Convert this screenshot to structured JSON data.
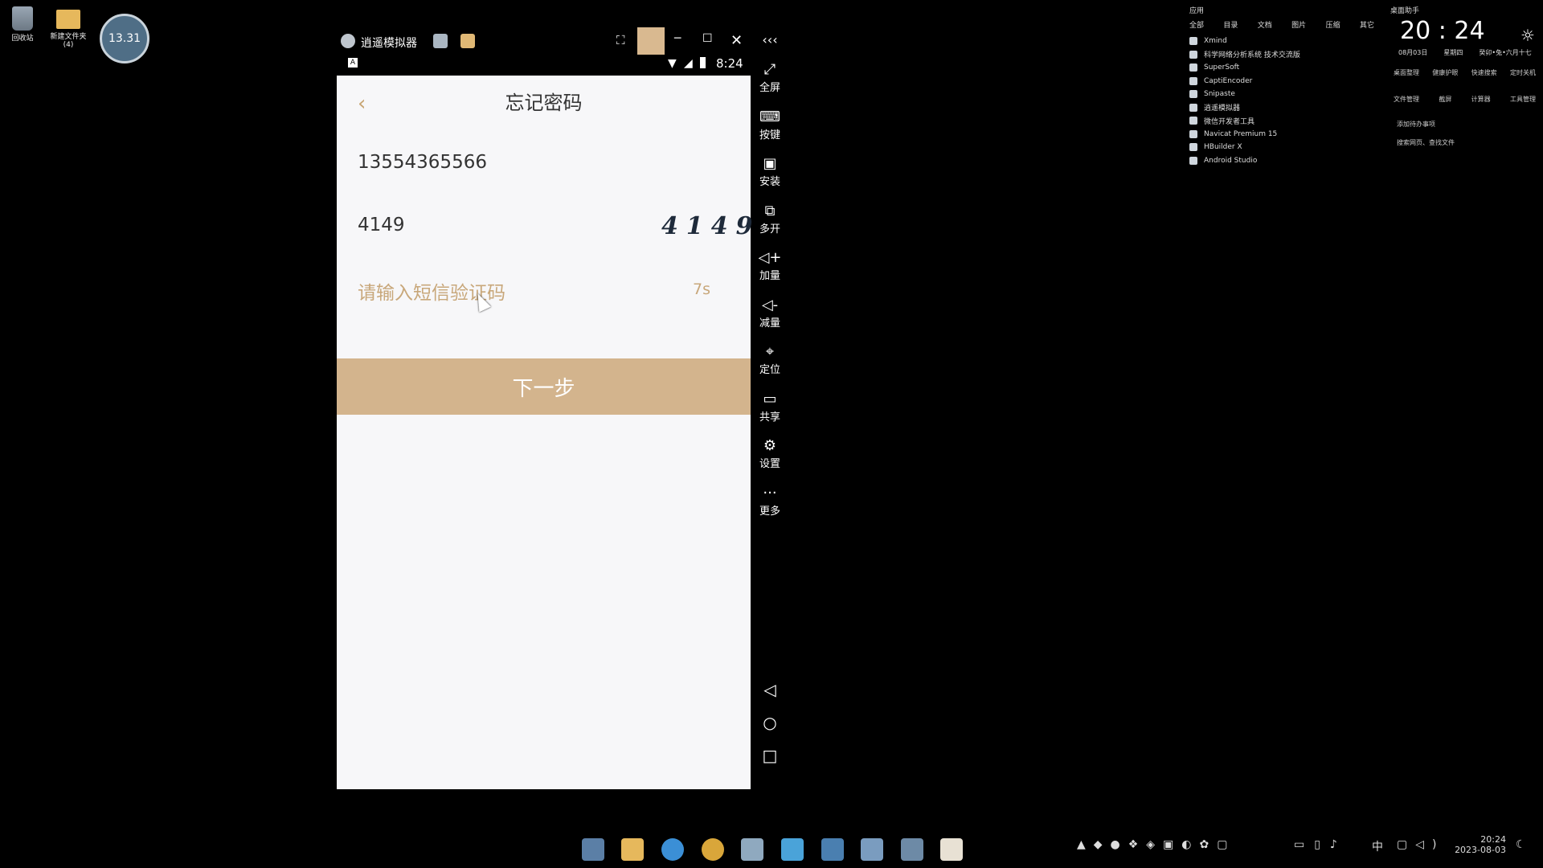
{
  "desktop": {
    "recycle_bin": "回收站",
    "new_folder": "新建文件夹",
    "new_folder_count": "(4)",
    "clock_widget": "13.31"
  },
  "emulator": {
    "title": "逍遥模拟器",
    "status_time": "8:24",
    "status_letter": "A"
  },
  "screen": {
    "title": "忘记密码",
    "phone_value": "13554365566",
    "captcha_value": "4149",
    "captcha_chars": [
      "4",
      "1",
      "4",
      "9"
    ],
    "sms_placeholder": "请输入短信验证码",
    "countdown": "7s",
    "next_button": "下一步"
  },
  "sidebar": {
    "items": [
      {
        "icon": "fullscreen-icon",
        "label": "全屏"
      },
      {
        "icon": "keyboard-icon",
        "label": "按键"
      },
      {
        "icon": "apk-icon",
        "label": "安装"
      },
      {
        "icon": "multi-open-icon",
        "label": "多开"
      },
      {
        "icon": "volume-up-icon",
        "label": "加量"
      },
      {
        "icon": "volume-down-icon",
        "label": "减量"
      },
      {
        "icon": "location-icon",
        "label": "定位"
      },
      {
        "icon": "folder-icon",
        "label": "共享"
      },
      {
        "icon": "gear-icon",
        "label": "设置"
      },
      {
        "icon": "more-icon",
        "label": "更多"
      }
    ]
  },
  "applist": {
    "header": "应用",
    "tabs": [
      "全部",
      "目录",
      "文档",
      "图片",
      "压缩",
      "其它"
    ],
    "items": [
      "Xmind",
      "科学网络分析系统 技术交流版",
      "SuperSoft",
      "CaptiEncoder",
      "Snipaste",
      "逍遥模拟器",
      "微信开发者工具",
      "Navicat Premium 15",
      "HBuilder X",
      "Android Studio"
    ]
  },
  "widget": {
    "header": "桌面助手",
    "time": "20 : 24",
    "date": "08月03日",
    "weekday": "星期四",
    "lunar": "癸卯•兔•六月十七",
    "row1": [
      "桌面整理",
      "健康护眼",
      "快速搜索",
      "定时关机"
    ],
    "row2": [
      "文件管理",
      "截屏",
      "计算器",
      "工具管理"
    ],
    "todo": "添加待办事项",
    "search": "搜索网页、查找文件"
  },
  "taskbar": {
    "ime": "中",
    "time": "20:24",
    "date": "2023-08-03"
  }
}
